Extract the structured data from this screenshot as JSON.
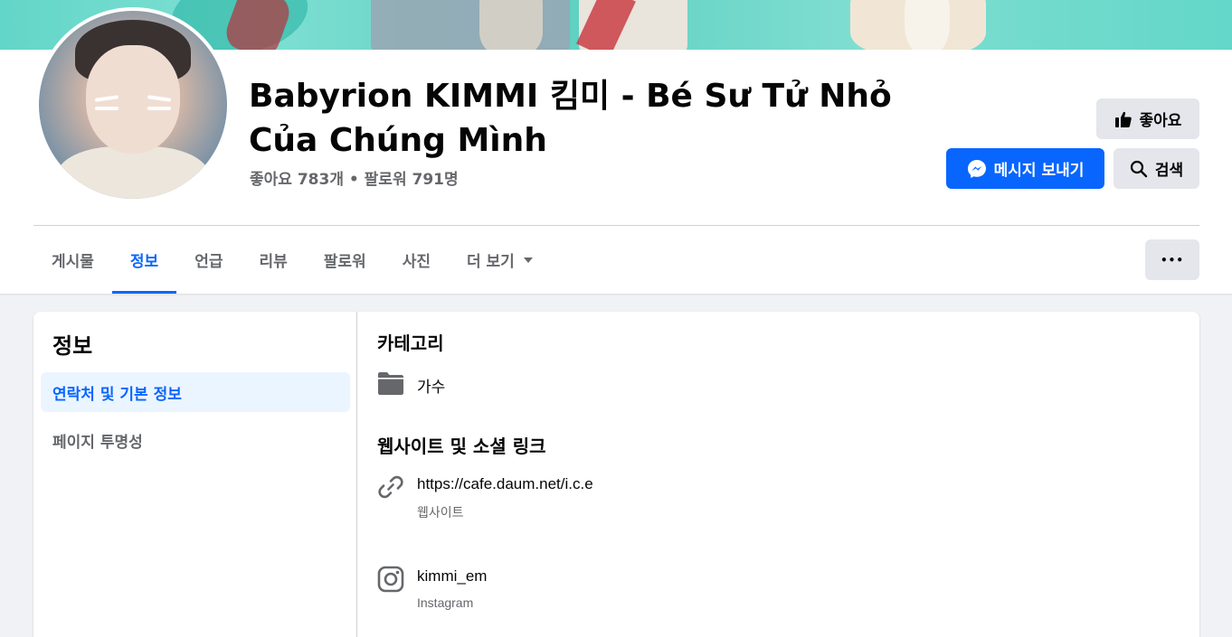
{
  "page": {
    "title": "Babyrion KIMMI 킴미 - Bé Sư Tử Nhỏ Của Chúng Mình",
    "stats": "좋아요 783개 • 팔로워 791명"
  },
  "actions": {
    "like_label": "좋아요",
    "message_label": "메시지 보내기",
    "search_label": "검색",
    "more_label": "•••"
  },
  "tabs": [
    {
      "label": "게시물"
    },
    {
      "label": "정보"
    },
    {
      "label": "언급"
    },
    {
      "label": "리뷰"
    },
    {
      "label": "팔로워"
    },
    {
      "label": "사진"
    },
    {
      "label": "더 보기"
    }
  ],
  "sidebar": {
    "title": "정보",
    "items": [
      {
        "label": "연락처 및 기본 정보"
      },
      {
        "label": "페이지 투명성"
      }
    ]
  },
  "category": {
    "heading": "카테고리",
    "value": "가수",
    "icon": "folder-icon"
  },
  "links": {
    "heading": "웹사이트 및 소셜 링크",
    "items": [
      {
        "text": "https://cafe.daum.net/i.c.e",
        "sub": "웹사이트",
        "icon": "link-icon"
      },
      {
        "text": "kimmi_em",
        "sub": "Instagram",
        "icon": "instagram-icon"
      }
    ]
  },
  "colors": {
    "accent": "#0866ff",
    "muted_text": "#65676b",
    "background": "#f0f2f5"
  }
}
